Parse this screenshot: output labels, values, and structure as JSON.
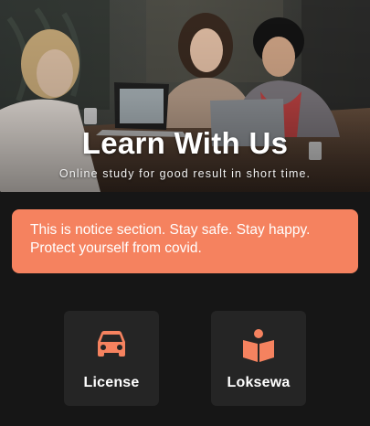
{
  "hero": {
    "title": "Learn With Us",
    "subtitle": "Online study for good result in short time."
  },
  "notice": {
    "text": "This is notice section. Stay safe. Stay happy. Protect yourself from covid."
  },
  "cards": [
    {
      "label": "License",
      "icon": "car-icon"
    },
    {
      "label": "Loksewa",
      "icon": "reading-person-icon"
    }
  ],
  "colors": {
    "background": "#161616",
    "accent": "#f5825f",
    "card": "#252525",
    "text": "#ffffff"
  }
}
